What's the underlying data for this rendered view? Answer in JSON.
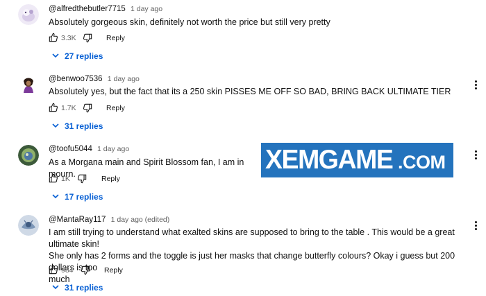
{
  "comments": [
    {
      "author": "@alfredthebutler7715",
      "time": "1 day ago",
      "text": "Absolutely gorgeous skin, definitely not worth the price but still very pretty",
      "likes": "3.3K",
      "reply_label": "Reply",
      "replies_label": "27 replies",
      "avatar_colors": [
        "#e9e4f2",
        "#c9b8e0",
        "#8a79a8"
      ]
    },
    {
      "author": "@benwoo7536",
      "time": "1 day ago",
      "text": "Absolutely yes, but the fact that its a 250 skin PISSES ME OFF SO BAD, BRING BACK ULTIMATE TIER",
      "likes": "1.7K",
      "reply_label": "Reply",
      "replies_label": "31 replies",
      "avatar_colors": [
        "#ffffff",
        "#6b4a2e",
        "#7c3a9a"
      ]
    },
    {
      "author": "@toofu5044",
      "time": "1 day ago",
      "text": "As a Morgana main and Spirit Blossom fan, I am in mourn.",
      "likes": "1K",
      "reply_label": "Reply",
      "replies_label": "17 replies",
      "avatar_colors": [
        "#3c5a3a",
        "#8fb06a",
        "#4d77a6"
      ]
    },
    {
      "author": "@MantaRay117",
      "time": "1 day ago (edited)",
      "text_lines": [
        "I am still trying to understand what exalted skins are supposed to bring to the table . This would be a great ultimate skin!",
        "She only has 2 forms and the toggle is just her masks that change butterfly colours? Okay i guess but 200 dollars is too",
        "much"
      ],
      "likes": "984",
      "reply_label": "Reply",
      "replies_label": "31 replies",
      "avatar_colors": [
        "#cfd9e6",
        "#7d97b8",
        "#3f5a80"
      ]
    }
  ],
  "watermark": {
    "main": "XEMGAME",
    "suffix": ".COM",
    "color": "#2473bd"
  },
  "colors": {
    "link": "#065fd4",
    "muted": "#606060",
    "text": "#0f0f0f"
  }
}
